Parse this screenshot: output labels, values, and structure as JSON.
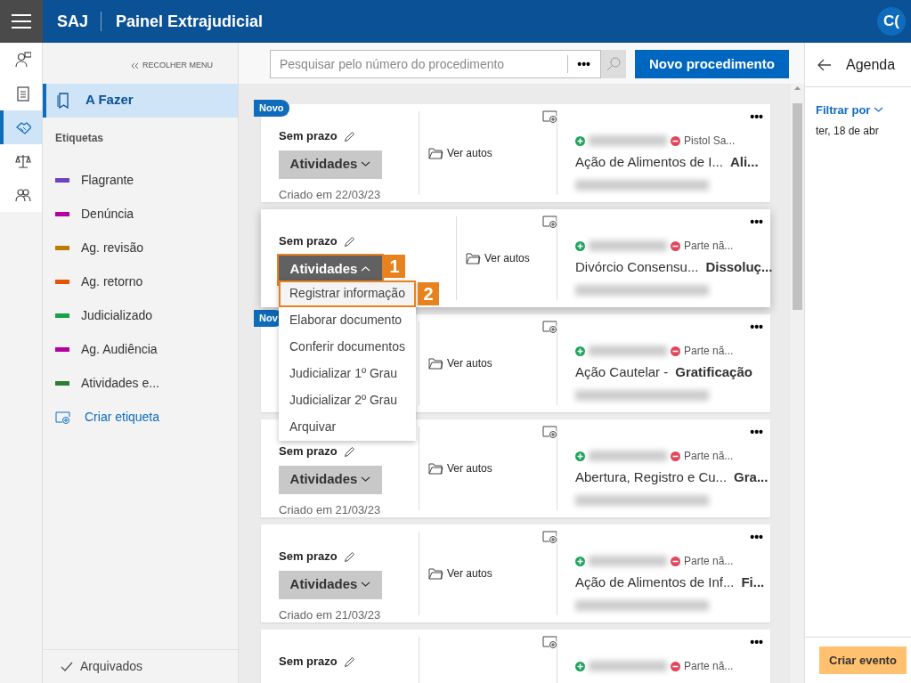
{
  "header": {
    "brand": "SAJ",
    "title": "Painel Extrajudicial",
    "avatar": "C("
  },
  "rail": [
    {
      "kind": "person",
      "selected": false
    },
    {
      "kind": "clipboard",
      "selected": false
    },
    {
      "kind": "handshake",
      "selected": true
    },
    {
      "kind": "scales",
      "selected": false
    },
    {
      "kind": "people",
      "selected": false
    }
  ],
  "nav": {
    "collapse": "RECOLHER MENU",
    "items": [
      {
        "label": "A Fazer",
        "selected": true
      }
    ],
    "section": "Etiquetas",
    "tags": [
      {
        "label": "Flagrante",
        "color": "#6f42c1"
      },
      {
        "label": "Denúncia",
        "color": "#b4009e"
      },
      {
        "label": "Ag. revisão",
        "color": "#b87c00"
      },
      {
        "label": "Ag. retorno",
        "color": "#e35205"
      },
      {
        "label": "Judicializado",
        "color": "#16a34a"
      },
      {
        "label": "Ag. Audiência",
        "color": "#b4009e"
      },
      {
        "label": "Atividades e...",
        "color": "#2e7d32"
      }
    ],
    "create": "Criar etiqueta",
    "footer": "Arquivados"
  },
  "search": {
    "placeholder": "Pesquisar pelo número do procedimento",
    "more": "•••",
    "new_button": "Novo procedimento"
  },
  "cards": [
    {
      "badge": "Novo",
      "deadline": "Sem prazo",
      "button": "Atividades",
      "expanded": false,
      "created": "Criado em 22/03/23",
      "link": "Ver autos",
      "party": "Pistol Sa...",
      "subject": "Ação de Alimentos de I...",
      "category": "Ali..."
    },
    {
      "deadline": "Sem prazo",
      "button": "Atividades",
      "expanded": true,
      "callout": "1",
      "link": "Ver autos",
      "party": "Parte nã...",
      "subject": "Divórcio Consensu...",
      "category": "Dissoluç..."
    },
    {
      "badge": "Nov",
      "expanded": false,
      "link": "Ver autos",
      "party": "Parte nã...",
      "subject": "Ação Cautelar -",
      "category": "Gratificação"
    },
    {
      "deadline": "Sem prazo",
      "button": "Atividades",
      "expanded": false,
      "created": "Criado em 21/03/23",
      "link": "Ver autos",
      "party": "Parte nã...",
      "subject": "Abertura, Registro e Cu...",
      "category": "Gra..."
    },
    {
      "deadline": "Sem prazo",
      "button": "Atividades",
      "expanded": false,
      "created": "Criado em 21/03/23",
      "link": "Ver autos",
      "party": "Parte nã...",
      "subject": "Ação de Alimentos de Inf...",
      "category": "Fi..."
    },
    {
      "deadline": "Sem prazo",
      "expanded": false,
      "party": "Parte nã..."
    }
  ],
  "menu": [
    {
      "label": "Registrar informação",
      "highlighted": true,
      "callout": "2"
    },
    {
      "label": "Elaborar documento",
      "highlighted": false
    },
    {
      "label": "Conferir documentos",
      "highlighted": false
    },
    {
      "label": "Judicializar 1º Grau",
      "highlighted": false
    },
    {
      "label": "Judicializar 2º Grau",
      "highlighted": false
    },
    {
      "label": "Arquivar",
      "highlighted": false
    }
  ],
  "agenda": {
    "title": "Agenda",
    "filter": "Filtrar por",
    "date": "ter, 18 de abr",
    "create": "Criar evento"
  }
}
